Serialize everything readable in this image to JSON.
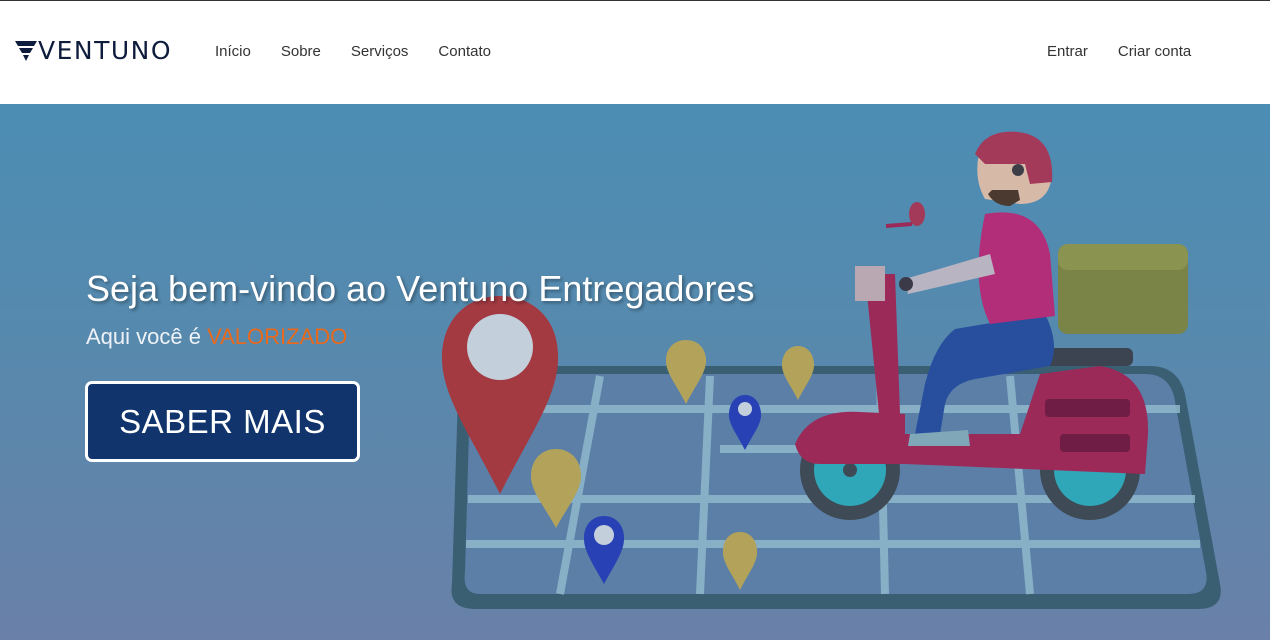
{
  "navbar": {
    "logo_text": "VENTUNO",
    "links": [
      "Início",
      "Sobre",
      "Serviços",
      "Contato"
    ],
    "right_links": [
      "Entrar",
      "Criar conta"
    ]
  },
  "hero": {
    "title": "Seja bem-vindo ao Ventuno Entregadores",
    "subtitle_prefix": "Aqui você é",
    "subtitle_highlight": "VALORIZADO",
    "cta_label": "SABER MAIS",
    "illustration": "delivery-scooter-map-icon"
  },
  "colors": {
    "brand_navy": "#10346b",
    "accent_orange": "#e8691c",
    "hero_blue": "#4c8db4"
  }
}
